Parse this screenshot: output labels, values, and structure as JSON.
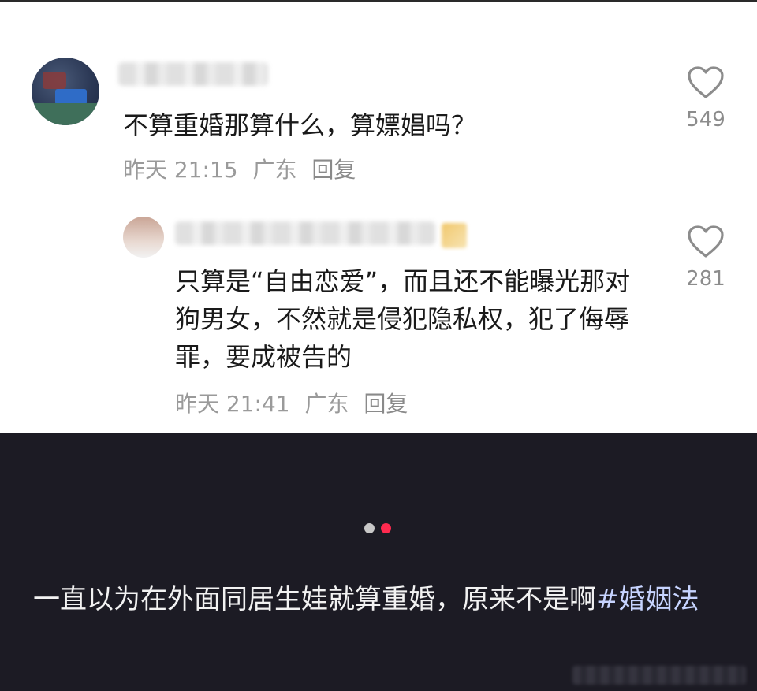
{
  "comments": [
    {
      "text": "不算重婚那算什么，算嫖娼吗？",
      "time": "昨天 21:15",
      "location": "广东",
      "reply_label": "回复",
      "likes": "549"
    },
    {
      "text": "只算是“自由恋爱”，而且还不能曝光那对狗男女，不然就是侵犯隐私权，犯了侮辱罪，要成被告的",
      "time": "昨天 21:41",
      "location": "广东",
      "reply_label": "回复",
      "likes": "281"
    }
  ],
  "caption": {
    "text": "一直以为在外面同居生娃就算重婚，原来不是啊",
    "hashtag": "#婚姻法"
  },
  "pager": {
    "count": 2,
    "active_index": 1
  },
  "colors": {
    "accent_dot": "#ff2a4f",
    "dark_bg": "#1c1b24",
    "hashtag": "#c7d4ff"
  }
}
